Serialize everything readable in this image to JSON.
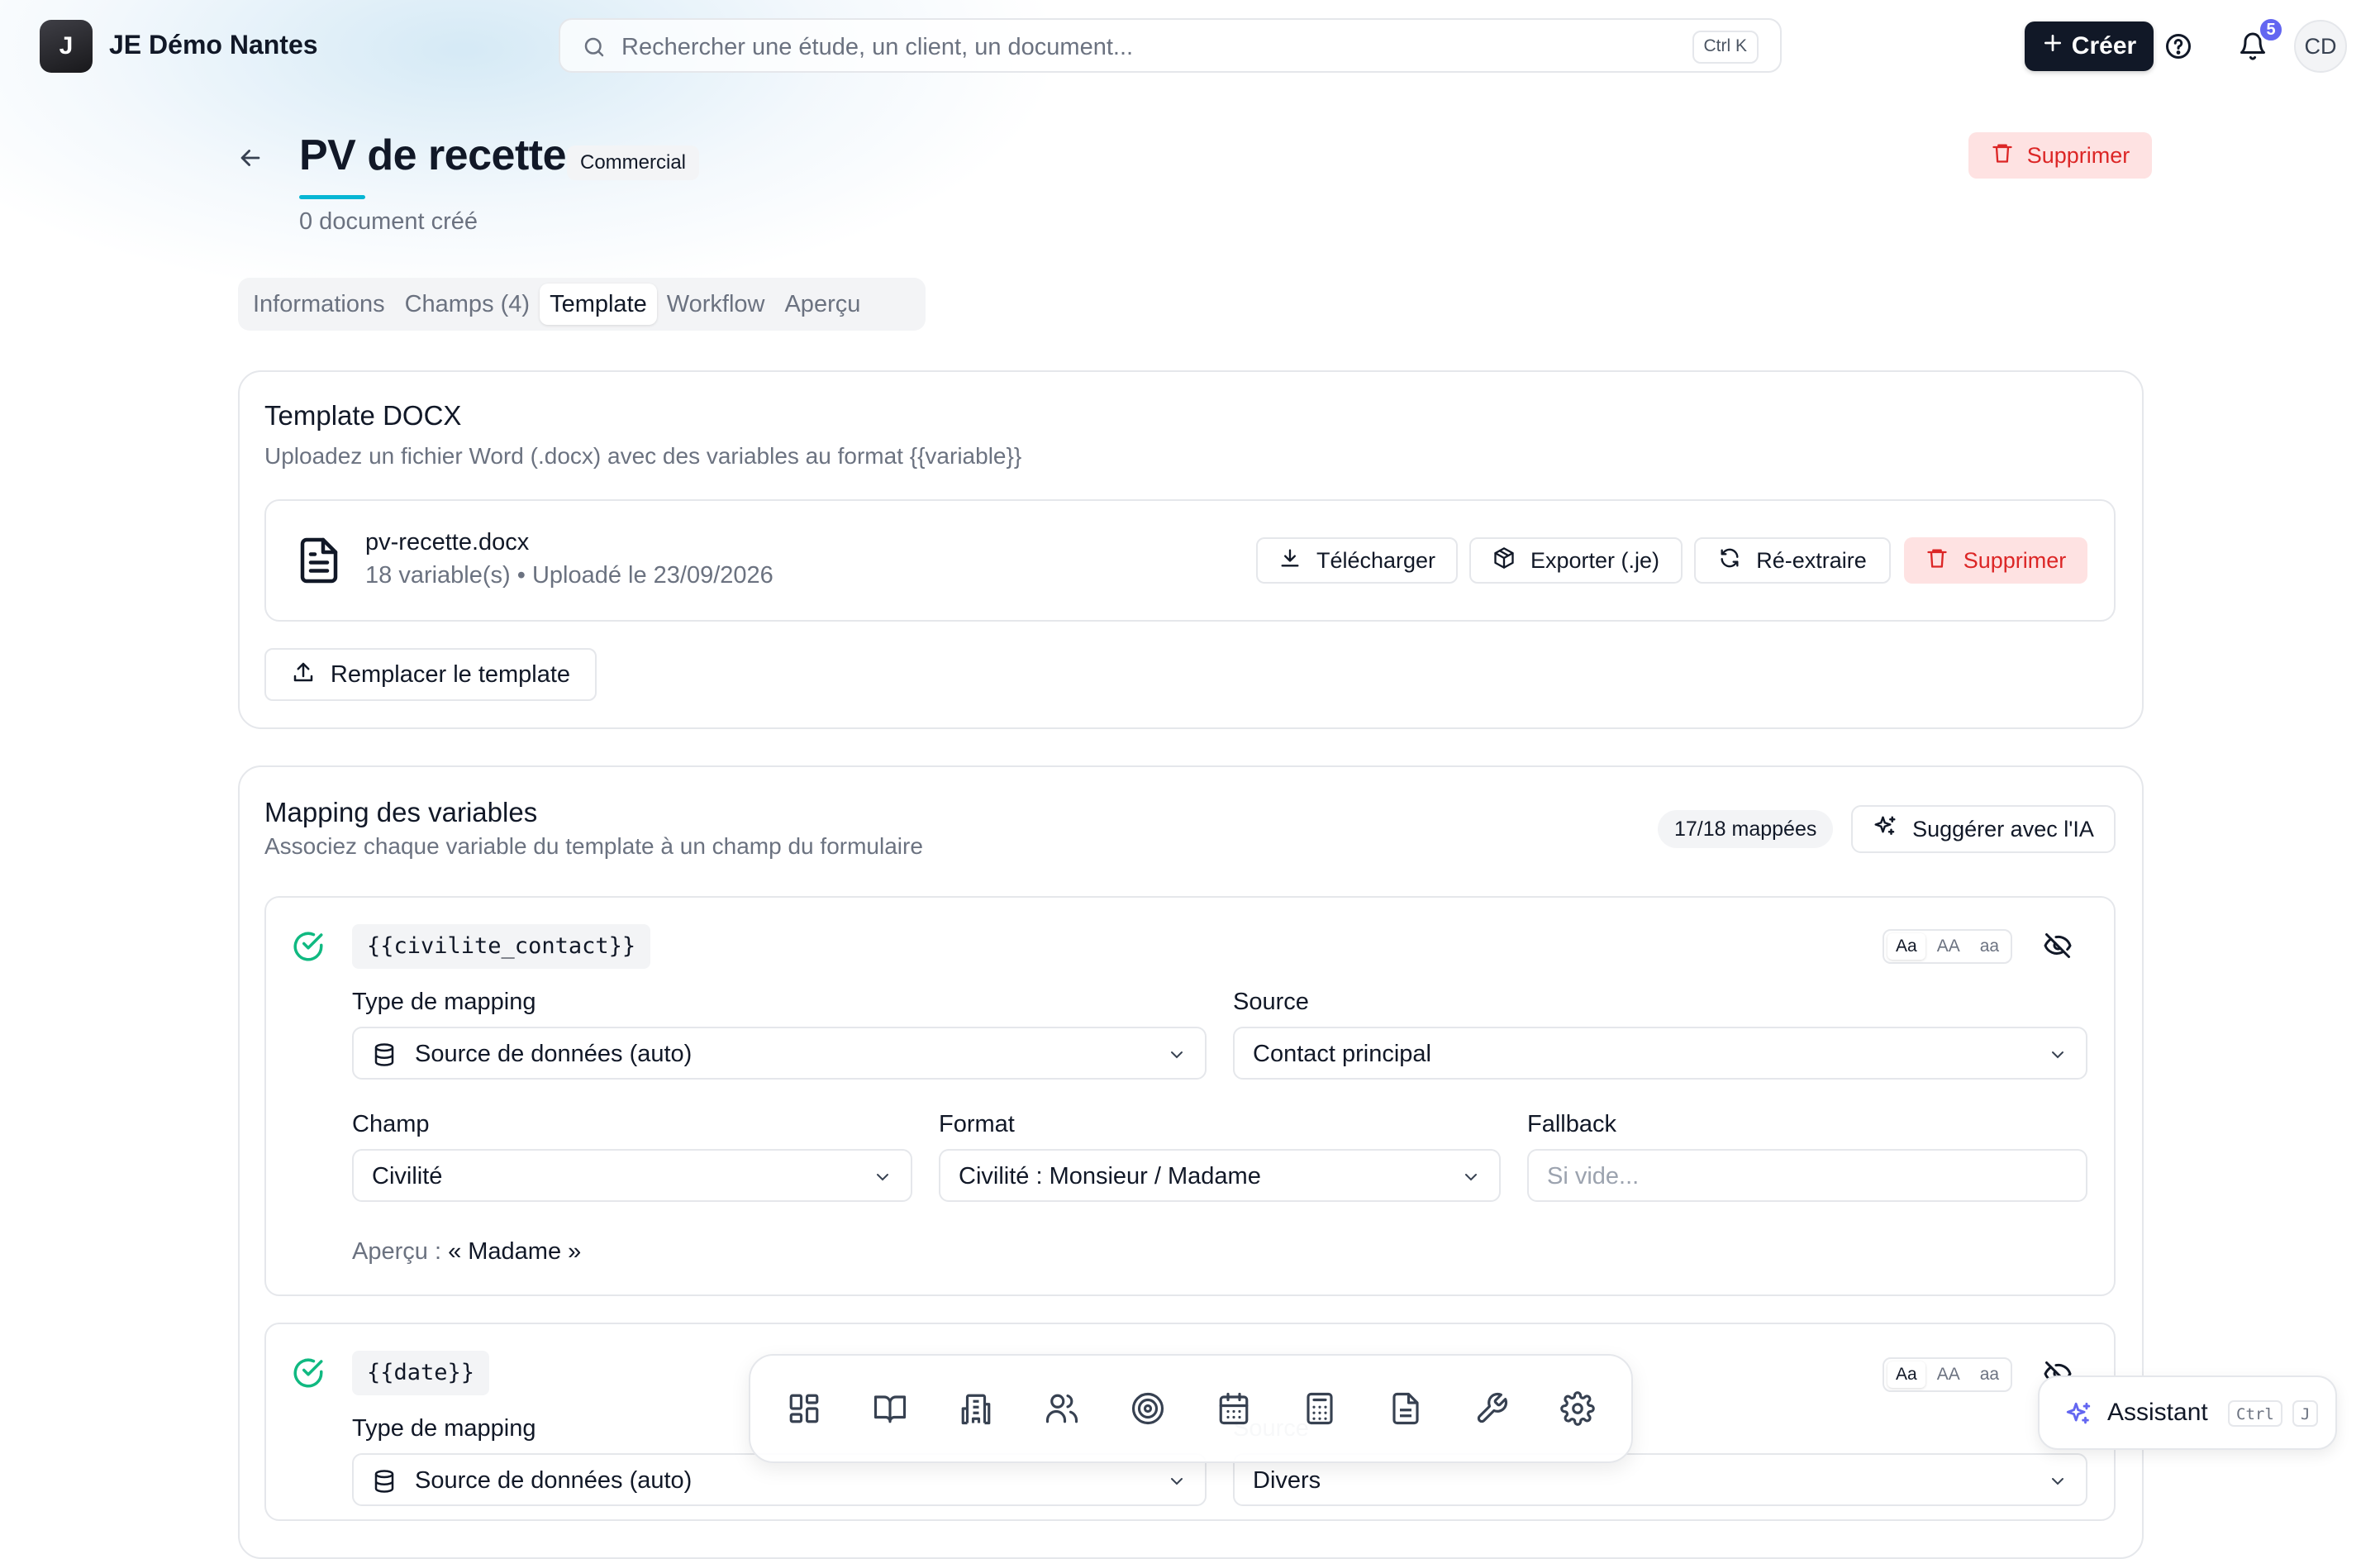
{
  "topbar": {
    "logo_letter": "J",
    "org_name": "JE Démo Nantes",
    "search_placeholder": "Rechercher une étude, un client, un document...",
    "search_shortcut": "Ctrl K",
    "create_label": "Créer",
    "notification_count": "5",
    "avatar_initials": "CD"
  },
  "header": {
    "title": "PV de recette",
    "category": "Commercial",
    "doc_count": "0 document créé",
    "delete_label": "Supprimer"
  },
  "tabs": [
    {
      "label": "Informations",
      "active": false
    },
    {
      "label": "Champs (4)",
      "active": false
    },
    {
      "label": "Template",
      "active": true
    },
    {
      "label": "Workflow",
      "active": false
    },
    {
      "label": "Aperçu",
      "active": false
    }
  ],
  "template_card": {
    "title": "Template DOCX",
    "subtitle": "Uploadez un fichier Word (.docx) avec des variables au format {{variable}}",
    "file_name": "pv-recette.docx",
    "file_meta": "18 variable(s) • Uploadé le 23/09/2026",
    "download_label": "Télécharger",
    "export_label": "Exporter (.je)",
    "reextract_label": "Ré-extraire",
    "delete_label": "Supprimer",
    "replace_label": "Remplacer le template"
  },
  "mapping_card": {
    "title": "Mapping des variables",
    "subtitle": "Associez chaque variable du template à un champ du formulaire",
    "mapped_count": "17/18 mappées",
    "suggest_label": "Suggérer avec l'IA",
    "case_options": [
      "Aa",
      "AA",
      "aa"
    ],
    "labels": {
      "mapping_type": "Type de mapping",
      "source": "Source",
      "field": "Champ",
      "format": "Format",
      "fallback": "Fallback"
    },
    "variables": [
      {
        "code": "{{civilite_contact}}",
        "mapping_type": "Source de données (auto)",
        "source": "Contact principal",
        "field": "Civilité",
        "format": "Civilité : Monsieur / Madame",
        "fallback_placeholder": "Si vide...",
        "preview_label": "Aperçu :",
        "preview_value": "« Madame »"
      },
      {
        "code": "{{date}}",
        "mapping_type": "Source de données (auto)",
        "source": "Divers"
      }
    ]
  },
  "dock": {
    "items": [
      "dashboard-icon",
      "book-icon",
      "building-icon",
      "users-icon",
      "target-icon",
      "calendar-icon",
      "calculator-icon",
      "document-icon",
      "wrench-icon",
      "settings-icon"
    ]
  },
  "assistant": {
    "label": "Assistant",
    "key1": "Ctrl",
    "key2": "J"
  },
  "colors": {
    "accent": "#06b6d4",
    "danger": "#dc2626",
    "danger_bg": "#fee2e2",
    "success": "#10b981",
    "badge": "#6366f1",
    "primary": "#111827"
  }
}
